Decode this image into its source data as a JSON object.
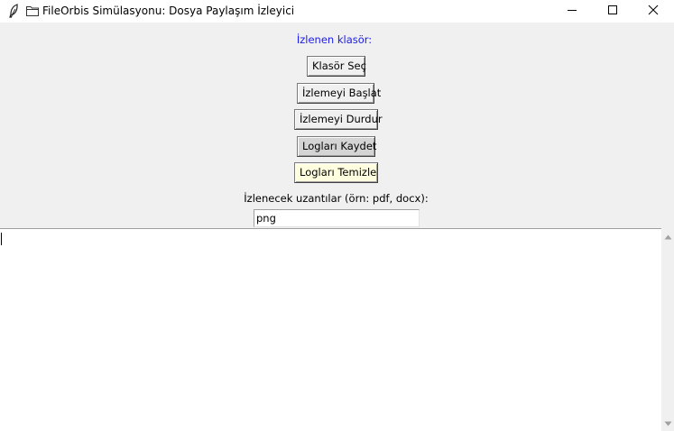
{
  "window": {
    "title": "FileOrbis Simülasyonu: Dosya Paylaşım İzleyici",
    "icons": {
      "app": "feather-icon",
      "folder": "folder-icon",
      "minimize": "minimize-icon",
      "maximize": "maximize-icon",
      "close": "close-icon"
    }
  },
  "main": {
    "watched_folder_label": "İzlenen klasör:",
    "buttons": {
      "select_folder": "Klasör Seç",
      "start_watching": "İzlemeyi Başlat",
      "stop_watching": "İzlemeyi Durdur",
      "save_logs": "Logları Kaydet",
      "clear_logs": "Logları Temizle"
    },
    "extensions_label": "İzlenecek uzantılar (örn: pdf, docx):",
    "extensions_value": "png",
    "log_text": ""
  },
  "colors": {
    "label_accent": "#1a1af0",
    "save_button_bg": "#d4d4d4",
    "clear_button_bg": "#ffffe0",
    "background": "#f0f0f0"
  }
}
